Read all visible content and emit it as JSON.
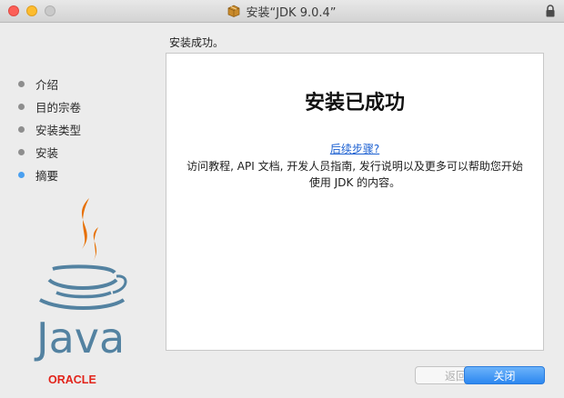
{
  "window": {
    "title": "安装“JDK 9.0.4”"
  },
  "heading": "安装成功。",
  "sidebar": {
    "steps": [
      {
        "label": "介绍",
        "active": false
      },
      {
        "label": "目的宗卷",
        "active": false
      },
      {
        "label": "安装类型",
        "active": false
      },
      {
        "label": "安装",
        "active": false
      },
      {
        "label": "摘要",
        "active": true
      }
    ]
  },
  "content": {
    "title": "安装已成功",
    "link": "后续步骤?",
    "body": "访问教程, API 文档, 开发人员指南, 发行说明以及更多可以帮助您开始使用 JDK 的内容。"
  },
  "logos": {
    "java": "Java",
    "oracle": "ORACLE"
  },
  "buttons": {
    "back": "返回",
    "close": "关闭"
  },
  "colors": {
    "accent": "#2c87f0",
    "active_dot": "#4aa0f0",
    "java_blue": "#5382a1",
    "java_orange": "#e76f00",
    "oracle_red": "#e2231a"
  }
}
